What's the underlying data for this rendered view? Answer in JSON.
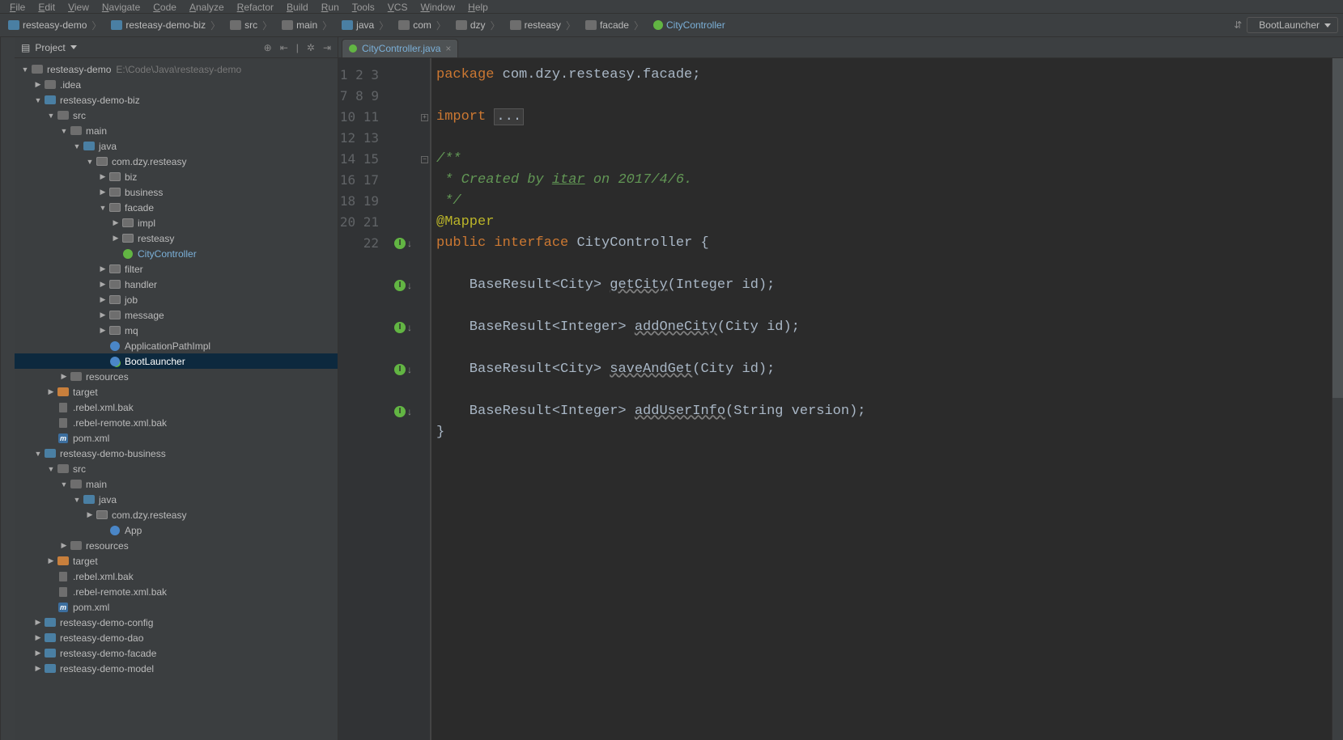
{
  "menu": [
    "File",
    "Edit",
    "View",
    "Navigate",
    "Code",
    "Analyze",
    "Refactor",
    "Build",
    "Run",
    "Tools",
    "VCS",
    "Window",
    "Help"
  ],
  "breadcrumbs": [
    {
      "icon": "module",
      "label": "resteasy-demo"
    },
    {
      "icon": "module",
      "label": "resteasy-demo-biz"
    },
    {
      "icon": "folder",
      "label": "src"
    },
    {
      "icon": "folder",
      "label": "main"
    },
    {
      "icon": "folder-sky",
      "label": "java"
    },
    {
      "icon": "folder",
      "label": "com"
    },
    {
      "icon": "folder",
      "label": "dzy"
    },
    {
      "icon": "folder",
      "label": "resteasy"
    },
    {
      "icon": "folder",
      "label": "facade"
    },
    {
      "icon": "circle-green",
      "label": "CityController"
    }
  ],
  "run_config": "BootLauncher",
  "sidebar": {
    "title": "Project"
  },
  "tree": [
    {
      "d": 0,
      "a": "down",
      "ic": "folder",
      "lbl": "resteasy-demo",
      "path": "E:\\Code\\Java\\resteasy-demo"
    },
    {
      "d": 1,
      "a": "right",
      "ic": "folder",
      "lbl": ".idea"
    },
    {
      "d": 1,
      "a": "down",
      "ic": "module",
      "lbl": "resteasy-demo-biz"
    },
    {
      "d": 2,
      "a": "down",
      "ic": "folder",
      "lbl": "src"
    },
    {
      "d": 3,
      "a": "down",
      "ic": "folder",
      "lbl": "main"
    },
    {
      "d": 4,
      "a": "down",
      "ic": "folder-blue",
      "lbl": "java"
    },
    {
      "d": 5,
      "a": "down",
      "ic": "pkg",
      "lbl": "com.dzy.resteasy"
    },
    {
      "d": 6,
      "a": "right",
      "ic": "pkg",
      "lbl": "biz"
    },
    {
      "d": 6,
      "a": "right",
      "ic": "pkg",
      "lbl": "business"
    },
    {
      "d": 6,
      "a": "down",
      "ic": "pkg",
      "lbl": "facade"
    },
    {
      "d": 7,
      "a": "right",
      "ic": "pkg",
      "lbl": "impl"
    },
    {
      "d": 7,
      "a": "right",
      "ic": "pkg",
      "lbl": "resteasy"
    },
    {
      "d": 7,
      "a": "",
      "ic": "class-g",
      "lbl": "CityController",
      "hi": true
    },
    {
      "d": 6,
      "a": "right",
      "ic": "pkg",
      "lbl": "filter"
    },
    {
      "d": 6,
      "a": "right",
      "ic": "pkg",
      "lbl": "handler"
    },
    {
      "d": 6,
      "a": "right",
      "ic": "pkg",
      "lbl": "job"
    },
    {
      "d": 6,
      "a": "right",
      "ic": "pkg",
      "lbl": "message"
    },
    {
      "d": 6,
      "a": "right",
      "ic": "pkg",
      "lbl": "mq"
    },
    {
      "d": 6,
      "a": "",
      "ic": "class-c",
      "lbl": "ApplicationPathImpl"
    },
    {
      "d": 6,
      "a": "",
      "ic": "class-cm",
      "lbl": "BootLauncher",
      "sel": true
    },
    {
      "d": 3,
      "a": "right",
      "ic": "folder",
      "lbl": "resources"
    },
    {
      "d": 2,
      "a": "right",
      "ic": "folder-orange",
      "lbl": "target"
    },
    {
      "d": 2,
      "a": "",
      "ic": "file",
      "lbl": ".rebel.xml.bak"
    },
    {
      "d": 2,
      "a": "",
      "ic": "file",
      "lbl": ".rebel-remote.xml.bak"
    },
    {
      "d": 2,
      "a": "",
      "ic": "m",
      "lbl": "pom.xml"
    },
    {
      "d": 1,
      "a": "down",
      "ic": "module",
      "lbl": "resteasy-demo-business"
    },
    {
      "d": 2,
      "a": "down",
      "ic": "folder",
      "lbl": "src"
    },
    {
      "d": 3,
      "a": "down",
      "ic": "folder",
      "lbl": "main"
    },
    {
      "d": 4,
      "a": "down",
      "ic": "folder-blue",
      "lbl": "java"
    },
    {
      "d": 5,
      "a": "right",
      "ic": "pkg",
      "lbl": "com.dzy.resteasy"
    },
    {
      "d": 6,
      "a": "",
      "ic": "class-c",
      "lbl": "App"
    },
    {
      "d": 3,
      "a": "right",
      "ic": "folder",
      "lbl": "resources"
    },
    {
      "d": 2,
      "a": "right",
      "ic": "folder-orange",
      "lbl": "target"
    },
    {
      "d": 2,
      "a": "",
      "ic": "file",
      "lbl": ".rebel.xml.bak"
    },
    {
      "d": 2,
      "a": "",
      "ic": "file",
      "lbl": ".rebel-remote.xml.bak"
    },
    {
      "d": 2,
      "a": "",
      "ic": "m",
      "lbl": "pom.xml"
    },
    {
      "d": 1,
      "a": "right",
      "ic": "module",
      "lbl": "resteasy-demo-config"
    },
    {
      "d": 1,
      "a": "right",
      "ic": "module",
      "lbl": "resteasy-demo-dao"
    },
    {
      "d": 1,
      "a": "right",
      "ic": "module",
      "lbl": "resteasy-demo-facade"
    },
    {
      "d": 1,
      "a": "right",
      "ic": "module",
      "lbl": "resteasy-demo-model"
    }
  ],
  "tab": {
    "name": "CityController.java"
  },
  "line_numbers": [
    "1",
    "2",
    "3",
    "7",
    "8",
    "9",
    "10",
    "11",
    "12",
    "13",
    "14",
    "15",
    "16",
    "17",
    "18",
    "19",
    "20",
    "21",
    "22"
  ],
  "gutter_icons": {
    "3": "fold",
    "8": "fold-open",
    "12": "impl",
    "14": "impl",
    "16": "impl",
    "18": "impl",
    "20": "impl"
  },
  "code": {
    "l1_kw": "package",
    "l1_rest": " com.dzy.resteasy.facade;",
    "l3_kw": "import",
    "l3_box": "...",
    "l8": "/**",
    "l9a": " * Created by ",
    "l9_u": "itar",
    "l9b": " on 2017/4/6.",
    "l10": " */",
    "l11": "@Mapper",
    "l12a": "public",
    "l12b": " interface",
    "l12c": " CityController {",
    "l14a": "    BaseResult<City> ",
    "l14m": "getCity",
    "l14b": "(Integer id);",
    "l16a": "    BaseResult<Integer> ",
    "l16m": "addOneCity",
    "l16b": "(City id);",
    "l18a": "    BaseResult<City> ",
    "l18m": "saveAndGet",
    "l18b": "(City id);",
    "l20a": "    BaseResult<Integer> ",
    "l20m": "addUserInfo",
    "l20b": "(String version);",
    "l21": "}"
  }
}
